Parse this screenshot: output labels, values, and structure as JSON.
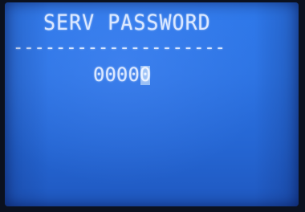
{
  "screen": {
    "title": "SERV PASSWORD",
    "divider": "--------------------",
    "password": {
      "entered_digits": "0000",
      "cursor_digit": "0"
    }
  },
  "colors": {
    "backlight": "#2c73e3",
    "segment_text": "#dbe8ff",
    "bezel": "#0b111f"
  }
}
